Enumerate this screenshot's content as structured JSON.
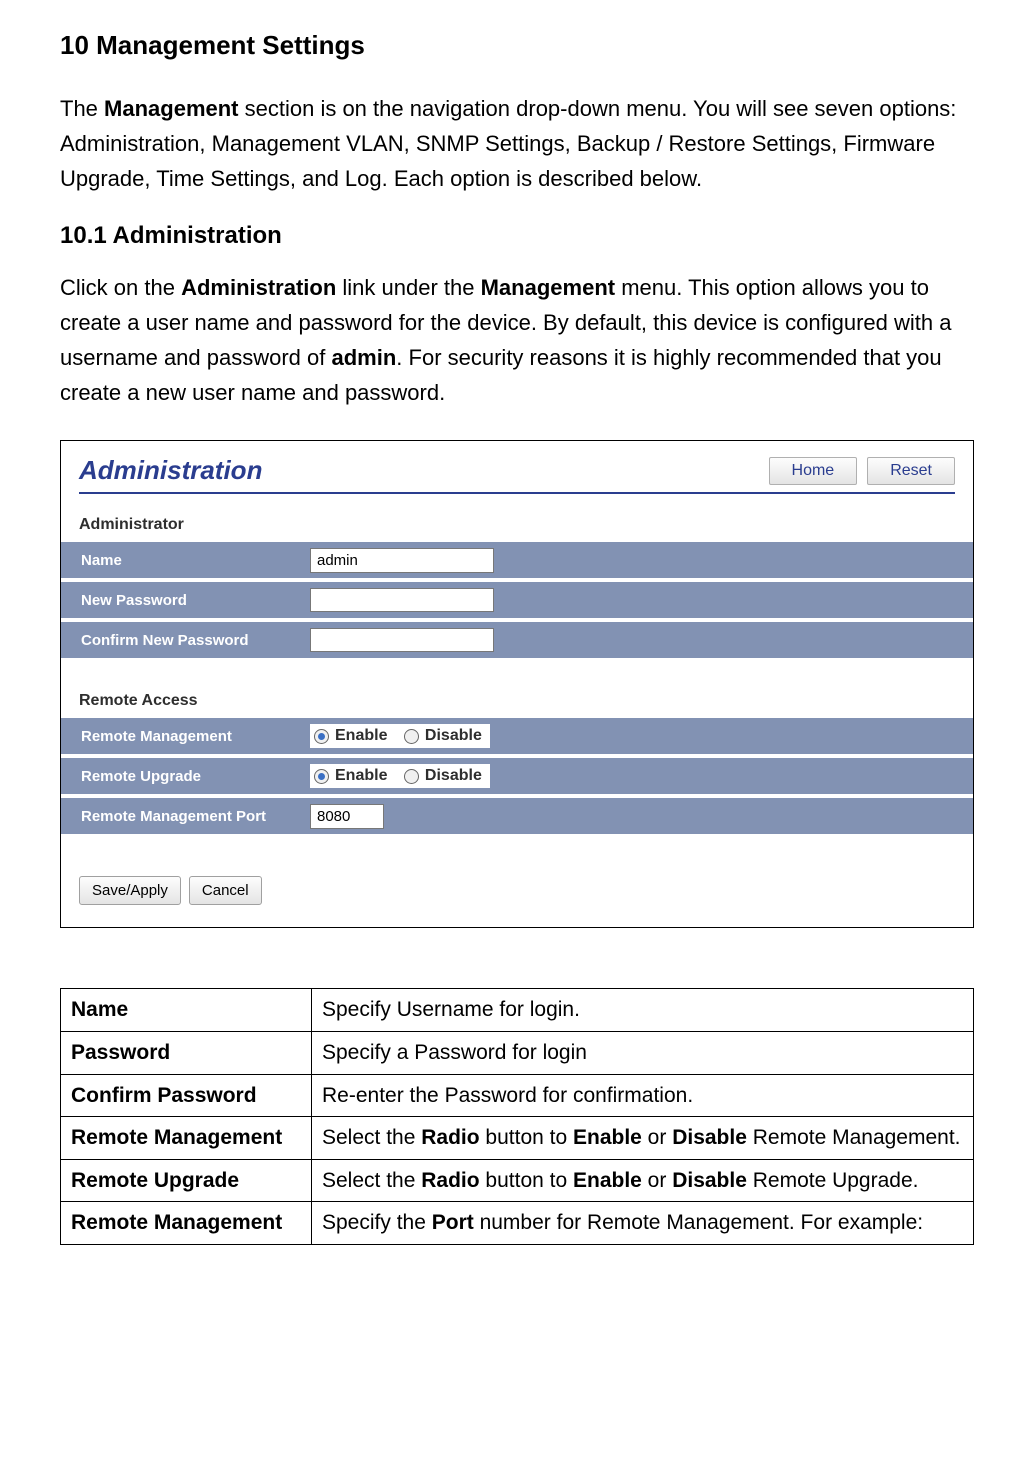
{
  "heading": "10 Management Settings",
  "intro": {
    "pre": "The ",
    "bold": "Management",
    "post": " section is on the navigation drop-down menu. You will see seven options: Administration, Management VLAN, SNMP Settings, Backup / Restore Settings, Firmware Upgrade, Time Settings, and Log. Each option is described below."
  },
  "sub_heading": "10.1 Administration",
  "admin_para": {
    "p1": "Click on the ",
    "b1": "Administration",
    "p2": " link under the ",
    "b2": "Management",
    "p3": " menu. This option allows you to create a user name and password for the device. By default, this device is configured with a username and password of ",
    "b3": "admin",
    "p4": ". For security reasons it is highly recommended that you create a new user name and password."
  },
  "ui": {
    "title": "Administration",
    "home_btn": "Home",
    "reset_btn": "Reset",
    "section_admin": "Administrator",
    "rows_admin": {
      "name_label": "Name",
      "name_value": "admin",
      "newpw_label": "New Password",
      "confpw_label": "Confirm New Password"
    },
    "section_remote": "Remote Access",
    "rows_remote": {
      "rm_label": "Remote Management",
      "ru_label": "Remote Upgrade",
      "rmp_label": "Remote Management Port",
      "rmp_value": "8080",
      "enable": "Enable",
      "disable": "Disable"
    },
    "save_btn": "Save/Apply",
    "cancel_btn": "Cancel"
  },
  "desc_table": [
    {
      "k": "Name",
      "v_pre": "Specify Username for login.",
      "bolds": []
    },
    {
      "k": "Password",
      "v_pre": "Specify a Password for login",
      "bolds": []
    },
    {
      "k": "Confirm Password",
      "v_pre": "Re-enter the Password for confirmation.",
      "bolds": []
    },
    {
      "k": "Remote Management",
      "b1": "Radio",
      "b2": "Enable",
      "b3": "Disable",
      "tail": " Remote Management."
    },
    {
      "k": "Remote Upgrade",
      "b1": "Radio",
      "b2": "Enable",
      "b3": "Disable",
      "tail": " Remote Upgrade."
    },
    {
      "k": "Remote Management",
      "b1": "Port",
      "tail2": " number for Remote Management. For example:"
    }
  ]
}
